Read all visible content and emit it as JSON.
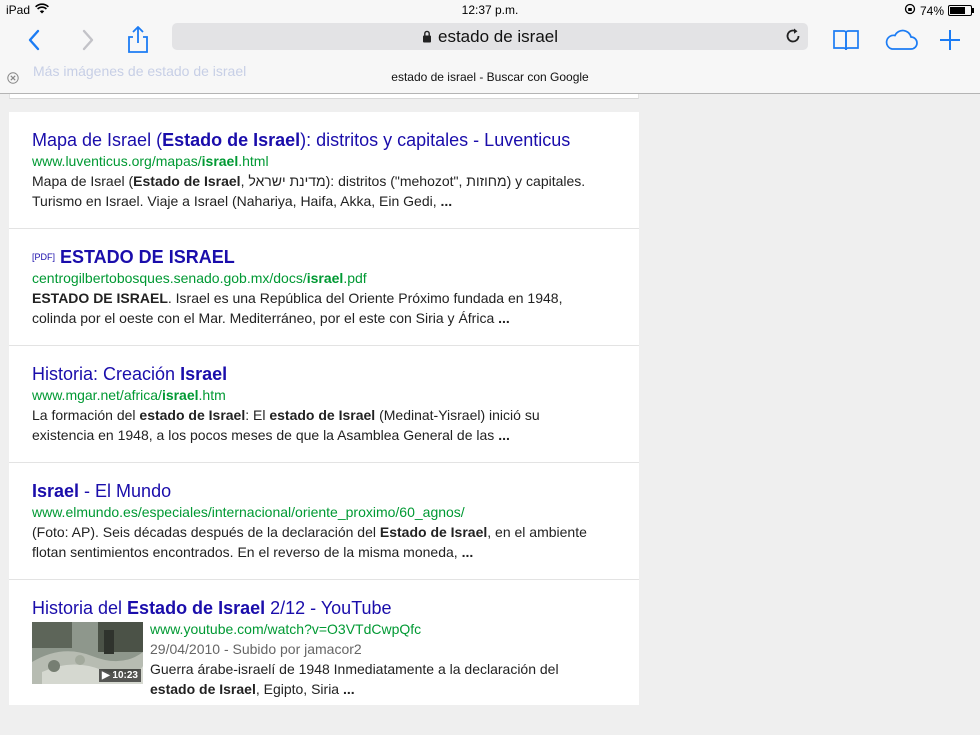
{
  "status": {
    "device": "iPad",
    "time": "12:37 p.m.",
    "battery_percent": "74%",
    "battery_level": 0.74
  },
  "toolbar": {
    "address": "estado de israel"
  },
  "tab": {
    "ghost_text": "Más imágenes de estado de israel",
    "title": "estado de israel - Buscar con Google"
  },
  "results": [
    {
      "title_parts": [
        "Mapa de Israel (",
        "Estado de Israel",
        "): distritos y capitales - Luventicus"
      ],
      "url_parts": [
        "www.luventicus.org/mapas/",
        "israel",
        ".html"
      ],
      "snippet_line1_parts": [
        "Mapa de Israel (",
        "Estado de Israel",
        ", מדינת ישראל): distritos (\"mehozot\", מחוזות) y capitales."
      ],
      "snippet_line2": "Turismo en Israel. Viaje a Israel (Nahariya, Haifa, Akka, Ein Gedi, ",
      "ellipsis": "..."
    },
    {
      "pdf_tag": "[PDF]",
      "title": "ESTADO DE ISRAEL",
      "url_parts": [
        "centrogilbertobosques.senado.gob.mx/docs/",
        "israel",
        ".pdf"
      ],
      "snippet_line1_parts": [
        "ESTADO DE ISRAEL",
        ". Israel es una República del Oriente Próximo fundada en 1948,"
      ],
      "snippet_line2": "colinda por el oeste con el Mar. Mediterráneo, por el este con Siria y África  ",
      "ellipsis": "..."
    },
    {
      "title_parts": [
        "Historia: Creación ",
        "Israel"
      ],
      "url_parts": [
        "www.mgar.net/africa/",
        "israel",
        ".htm"
      ],
      "snippet_line1_parts": [
        "La formación del ",
        "estado de Israel",
        ": El ",
        "estado de Israel",
        " (Medinat-Yisrael) inició su"
      ],
      "snippet_line2": "existencia en 1948, a los pocos meses de que la Asamblea General de las ",
      "ellipsis": "..."
    },
    {
      "title_parts": [
        "Israel",
        " - El Mundo"
      ],
      "url": "www.elmundo.es/especiales/internacional/oriente_proximo/60_agnos/",
      "snippet_line1_parts": [
        "(Foto: AP). Seis décadas después de la declaración del ",
        "Estado de Israel",
        ", en el ambiente"
      ],
      "snippet_line2": "flotan sentimientos encontrados. En el reverso de la misma moneda, ",
      "ellipsis": "..."
    },
    {
      "title_parts": [
        "Historia del ",
        "Estado de Israel",
        " 2/12 - YouTube"
      ],
      "url": "www.youtube.com/watch?v=O3VTdCwpQfc",
      "meta": "29/04/2010 - Subido por jamacor2",
      "snippet_line1": "Guerra árabe-israelí de 1948 Inmediatamente a la declaración del",
      "snippet_line2_parts": [
        "estado de Israel",
        ", Egipto, Siria "
      ],
      "ellipsis": "...",
      "duration": "▶ 10:23"
    }
  ]
}
